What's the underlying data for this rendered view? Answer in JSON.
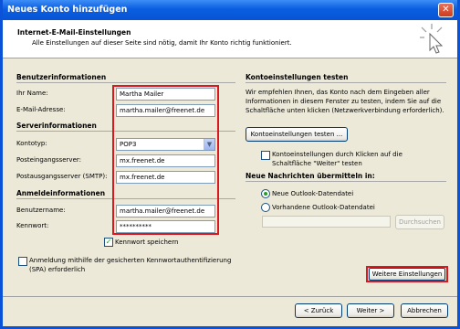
{
  "window": {
    "title": "Neues Konto hinzufügen",
    "close_glyph": "✕"
  },
  "header": {
    "title": "Internet-E-Mail-Einstellungen",
    "subtitle": "Alle Einstellungen auf dieser Seite sind nötig, damit Ihr Konto richtig funktioniert."
  },
  "left": {
    "user_section": "Benutzerinformationen",
    "name_label": "Ihr Name:",
    "name_value": "Martha Mailer",
    "email_label": "E-Mail-Adresse:",
    "email_value": "martha.mailer@freenet.de",
    "server_section": "Serverinformationen",
    "account_type_label": "Kontotyp:",
    "account_type_value": "POP3",
    "incoming_label": "Posteingangsserver:",
    "incoming_value": "mx.freenet.de",
    "outgoing_label": "Postausgangsserver (SMTP):",
    "outgoing_value": "mx.freenet.de",
    "login_section": "Anmeldeinformationen",
    "username_label": "Benutzername:",
    "username_value": "martha.mailer@freenet.de",
    "password_label": "Kennwort:",
    "password_value": "**********",
    "remember_password_label": "Kennwort speichern",
    "remember_password_checked": true,
    "spa_label_line1": "Anmeldung mithilfe der gesicherten Kennwortauthentifizierung",
    "spa_label_line2": "(SPA) erforderlich",
    "spa_checked": false
  },
  "right": {
    "test_section": "Kontoeinstellungen testen",
    "test_desc_line1": "Wir empfehlen Ihnen, das Konto nach dem Eingeben aller",
    "test_desc_line2": "Informationen in diesem Fenster zu testen, indem Sie auf die",
    "test_desc_line3": "Schaltfläche unten klicken (Netzwerkverbindung erforderlich).",
    "test_button": "Kontoeinstellungen testen ...",
    "auto_test_line1": "Kontoeinstellungen durch Klicken auf die",
    "auto_test_line2": "Schaltfläche \"Weiter\" testen",
    "auto_test_checked": false,
    "deliver_section": "Neue Nachrichten übermitteln in:",
    "radio_new": "Neue Outlook-Datendatei",
    "radio_existing": "Vorhandene Outlook-Datendatei",
    "browse_button": "Durchsuchen",
    "more_settings_button": "Weitere Einstellungen"
  },
  "footer": {
    "back": "< Zurück",
    "next": "Weiter >",
    "cancel": "Abbrechen"
  },
  "colors": {
    "highlight": "#d9181f",
    "title_bar": "#0b5ee0",
    "check": "#21a121"
  }
}
